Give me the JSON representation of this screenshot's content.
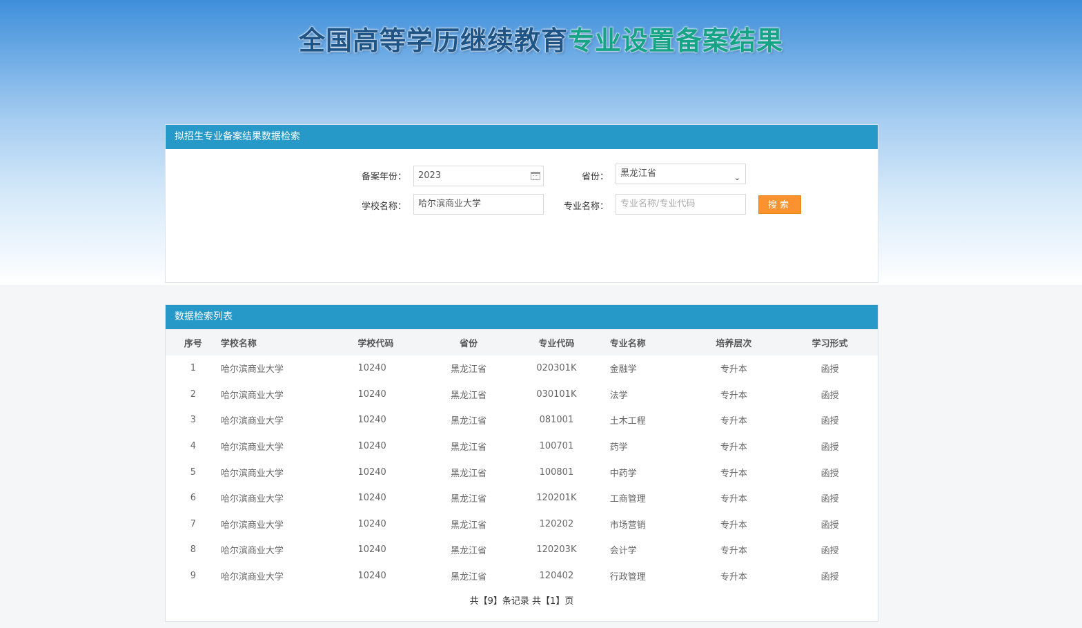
{
  "header": {
    "title_part1": "全国高等学历继续教育",
    "title_part2": "专业设置备案结果",
    "title_color1": "#1f5486",
    "title_color2": "#16a386"
  },
  "search": {
    "panel_title": "拟招生专业备案结果数据检索",
    "year_label": "备案年份：",
    "year_value": "2023",
    "province_label": "省份：",
    "province_value": "黑龙江省",
    "school_label": "学校名称：",
    "school_value": "哈尔滨商业大学",
    "major_label": "专业名称：",
    "major_placeholder": "专业名称/专业代码",
    "search_button": "搜索",
    "calendar_icon": "calendar-icon",
    "dropdown_icon": "chevron-down-icon"
  },
  "list": {
    "panel_title": "数据检索列表",
    "columns": [
      "序号",
      "学校名称",
      "学校代码",
      "省份",
      "专业代码",
      "专业名称",
      "培养层次",
      "学习形式"
    ],
    "rows": [
      [
        "1",
        "哈尔滨商业大学",
        "10240",
        "黑龙江省",
        "020301K",
        "金融学",
        "专升本",
        "函授"
      ],
      [
        "2",
        "哈尔滨商业大学",
        "10240",
        "黑龙江省",
        "030101K",
        "法学",
        "专升本",
        "函授"
      ],
      [
        "3",
        "哈尔滨商业大学",
        "10240",
        "黑龙江省",
        "081001",
        "土木工程",
        "专升本",
        "函授"
      ],
      [
        "4",
        "哈尔滨商业大学",
        "10240",
        "黑龙江省",
        "100701",
        "药学",
        "专升本",
        "函授"
      ],
      [
        "5",
        "哈尔滨商业大学",
        "10240",
        "黑龙江省",
        "100801",
        "中药学",
        "专升本",
        "函授"
      ],
      [
        "6",
        "哈尔滨商业大学",
        "10240",
        "黑龙江省",
        "120201K",
        "工商管理",
        "专升本",
        "函授"
      ],
      [
        "7",
        "哈尔滨商业大学",
        "10240",
        "黑龙江省",
        "120202",
        "市场营销",
        "专升本",
        "函授"
      ],
      [
        "8",
        "哈尔滨商业大学",
        "10240",
        "黑龙江省",
        "120203K",
        "会计学",
        "专升本",
        "函授"
      ],
      [
        "9",
        "哈尔滨商业大学",
        "10240",
        "黑龙江省",
        "120402",
        "行政管理",
        "专升本",
        "函授"
      ]
    ],
    "pager": "共【9】条记录 共【1】页"
  },
  "colors": {
    "panel_header": "#2799c9",
    "search_button": "#fa9230"
  }
}
